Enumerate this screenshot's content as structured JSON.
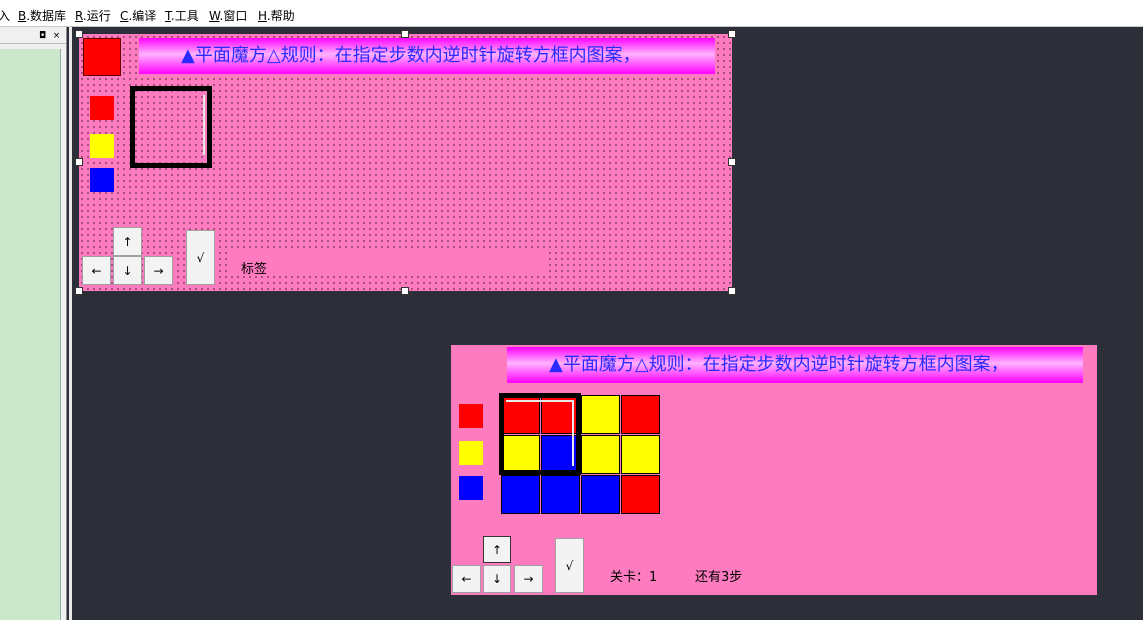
{
  "menu": {
    "partial": "入",
    "items": [
      {
        "key": "B",
        "label": ".数据库"
      },
      {
        "key": "R",
        "label": ".运行"
      },
      {
        "key": "C",
        "label": ".编译"
      },
      {
        "key": "T",
        "label": ".工具"
      },
      {
        "key": "W",
        "label": ".窗口"
      },
      {
        "key": "H",
        "label": ".帮助"
      }
    ]
  },
  "panel": {
    "pin_glyph": "◘",
    "close_glyph": "×"
  },
  "rule_text": "▲平面魔方△规则：在指定步数内逆时针旋转方框内图案，",
  "colors": {
    "red": "#ff0000",
    "yellow": "#ffff00",
    "blue": "#0000ff",
    "pink": "#ff7bbf"
  },
  "design_form": {
    "status_label": "标签",
    "btn_up": "↑",
    "btn_down": "↓",
    "btn_left": "←",
    "btn_right": "→",
    "btn_confirm": "√"
  },
  "run_form": {
    "level_label": "关卡：1",
    "steps_label": "还有3步",
    "btn_up": "↑",
    "btn_down": "↓",
    "btn_left": "←",
    "btn_right": "→",
    "btn_confirm": "√",
    "grid": [
      [
        "red",
        "red",
        "yellow",
        "red"
      ],
      [
        "yellow",
        "blue",
        "yellow",
        "yellow"
      ],
      [
        "blue",
        "blue",
        "blue",
        "red"
      ]
    ]
  }
}
